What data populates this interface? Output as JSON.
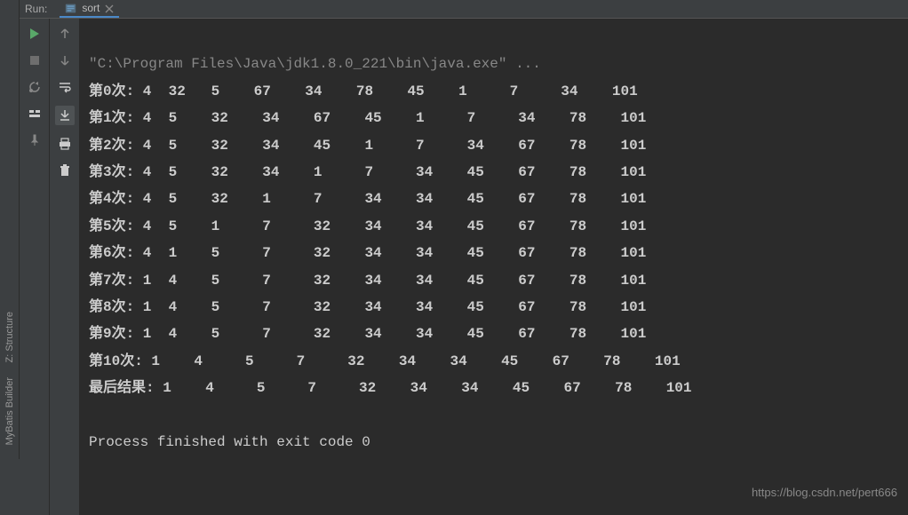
{
  "header": {
    "run_label": "Run:",
    "tab_name": "sort"
  },
  "left_sidebar": {
    "tabs": [
      "Z: Structure",
      "MyBatis Builder"
    ]
  },
  "console": {
    "command_line": "\"C:\\Program Files\\Java\\jdk1.8.0_221\\bin\\java.exe\" ...",
    "iterations": [
      {
        "label": "第0次:",
        "values": [
          "4",
          "32",
          " 5 ",
          " 67 ",
          " 34 ",
          " 78 ",
          " 45 ",
          " 1  ",
          " 7  ",
          " 34 ",
          " 101"
        ]
      },
      {
        "label": "第1次:",
        "values": [
          "4",
          "5 ",
          " 32 ",
          " 34 ",
          " 67 ",
          " 45 ",
          " 1  ",
          " 7  ",
          " 34 ",
          " 78 ",
          " 101"
        ]
      },
      {
        "label": "第2次:",
        "values": [
          "4",
          "5 ",
          " 32 ",
          " 34 ",
          " 45 ",
          " 1  ",
          " 7  ",
          " 34 ",
          " 67 ",
          " 78 ",
          " 101"
        ]
      },
      {
        "label": "第3次:",
        "values": [
          "4",
          "5 ",
          " 32 ",
          " 34 ",
          " 1  ",
          " 7  ",
          " 34 ",
          " 45 ",
          " 67 ",
          " 78 ",
          " 101"
        ]
      },
      {
        "label": "第4次:",
        "values": [
          "4",
          "5 ",
          " 32 ",
          " 1  ",
          " 7  ",
          " 34 ",
          " 34 ",
          " 45 ",
          " 67 ",
          " 78 ",
          " 101"
        ]
      },
      {
        "label": "第5次:",
        "values": [
          "4",
          "5 ",
          " 1  ",
          " 7  ",
          " 32 ",
          " 34 ",
          " 34 ",
          " 45 ",
          " 67 ",
          " 78 ",
          " 101"
        ]
      },
      {
        "label": "第6次:",
        "values": [
          "4",
          "1 ",
          " 5  ",
          " 7  ",
          " 32 ",
          " 34 ",
          " 34 ",
          " 45 ",
          " 67 ",
          " 78 ",
          " 101"
        ]
      },
      {
        "label": "第7次:",
        "values": [
          "1",
          "4 ",
          " 5  ",
          " 7  ",
          " 32 ",
          " 34 ",
          " 34 ",
          " 45 ",
          " 67 ",
          " 78 ",
          " 101"
        ]
      },
      {
        "label": "第8次:",
        "values": [
          "1",
          "4 ",
          " 5  ",
          " 7  ",
          " 32 ",
          " 34 ",
          " 34 ",
          " 45 ",
          " 67 ",
          " 78 ",
          " 101"
        ]
      },
      {
        "label": "第9次:",
        "values": [
          "1",
          "4 ",
          " 5  ",
          " 7  ",
          " 32 ",
          " 34 ",
          " 34 ",
          " 45 ",
          " 67 ",
          " 78 ",
          " 101"
        ]
      },
      {
        "label": "第10次:",
        "values": [
          "1 ",
          " 4  ",
          " 5  ",
          " 7  ",
          " 32 ",
          " 34 ",
          " 34 ",
          " 45 ",
          " 67 ",
          " 78 ",
          " 101"
        ]
      },
      {
        "label": "最后结果:",
        "values": [
          "1 ",
          " 4  ",
          " 5  ",
          " 7  ",
          " 32 ",
          " 34 ",
          " 34 ",
          " 45 ",
          " 67 ",
          " 78 ",
          " 101"
        ]
      }
    ],
    "exit_line": "Process finished with exit code 0"
  },
  "watermark": "https://blog.csdn.net/pert666"
}
